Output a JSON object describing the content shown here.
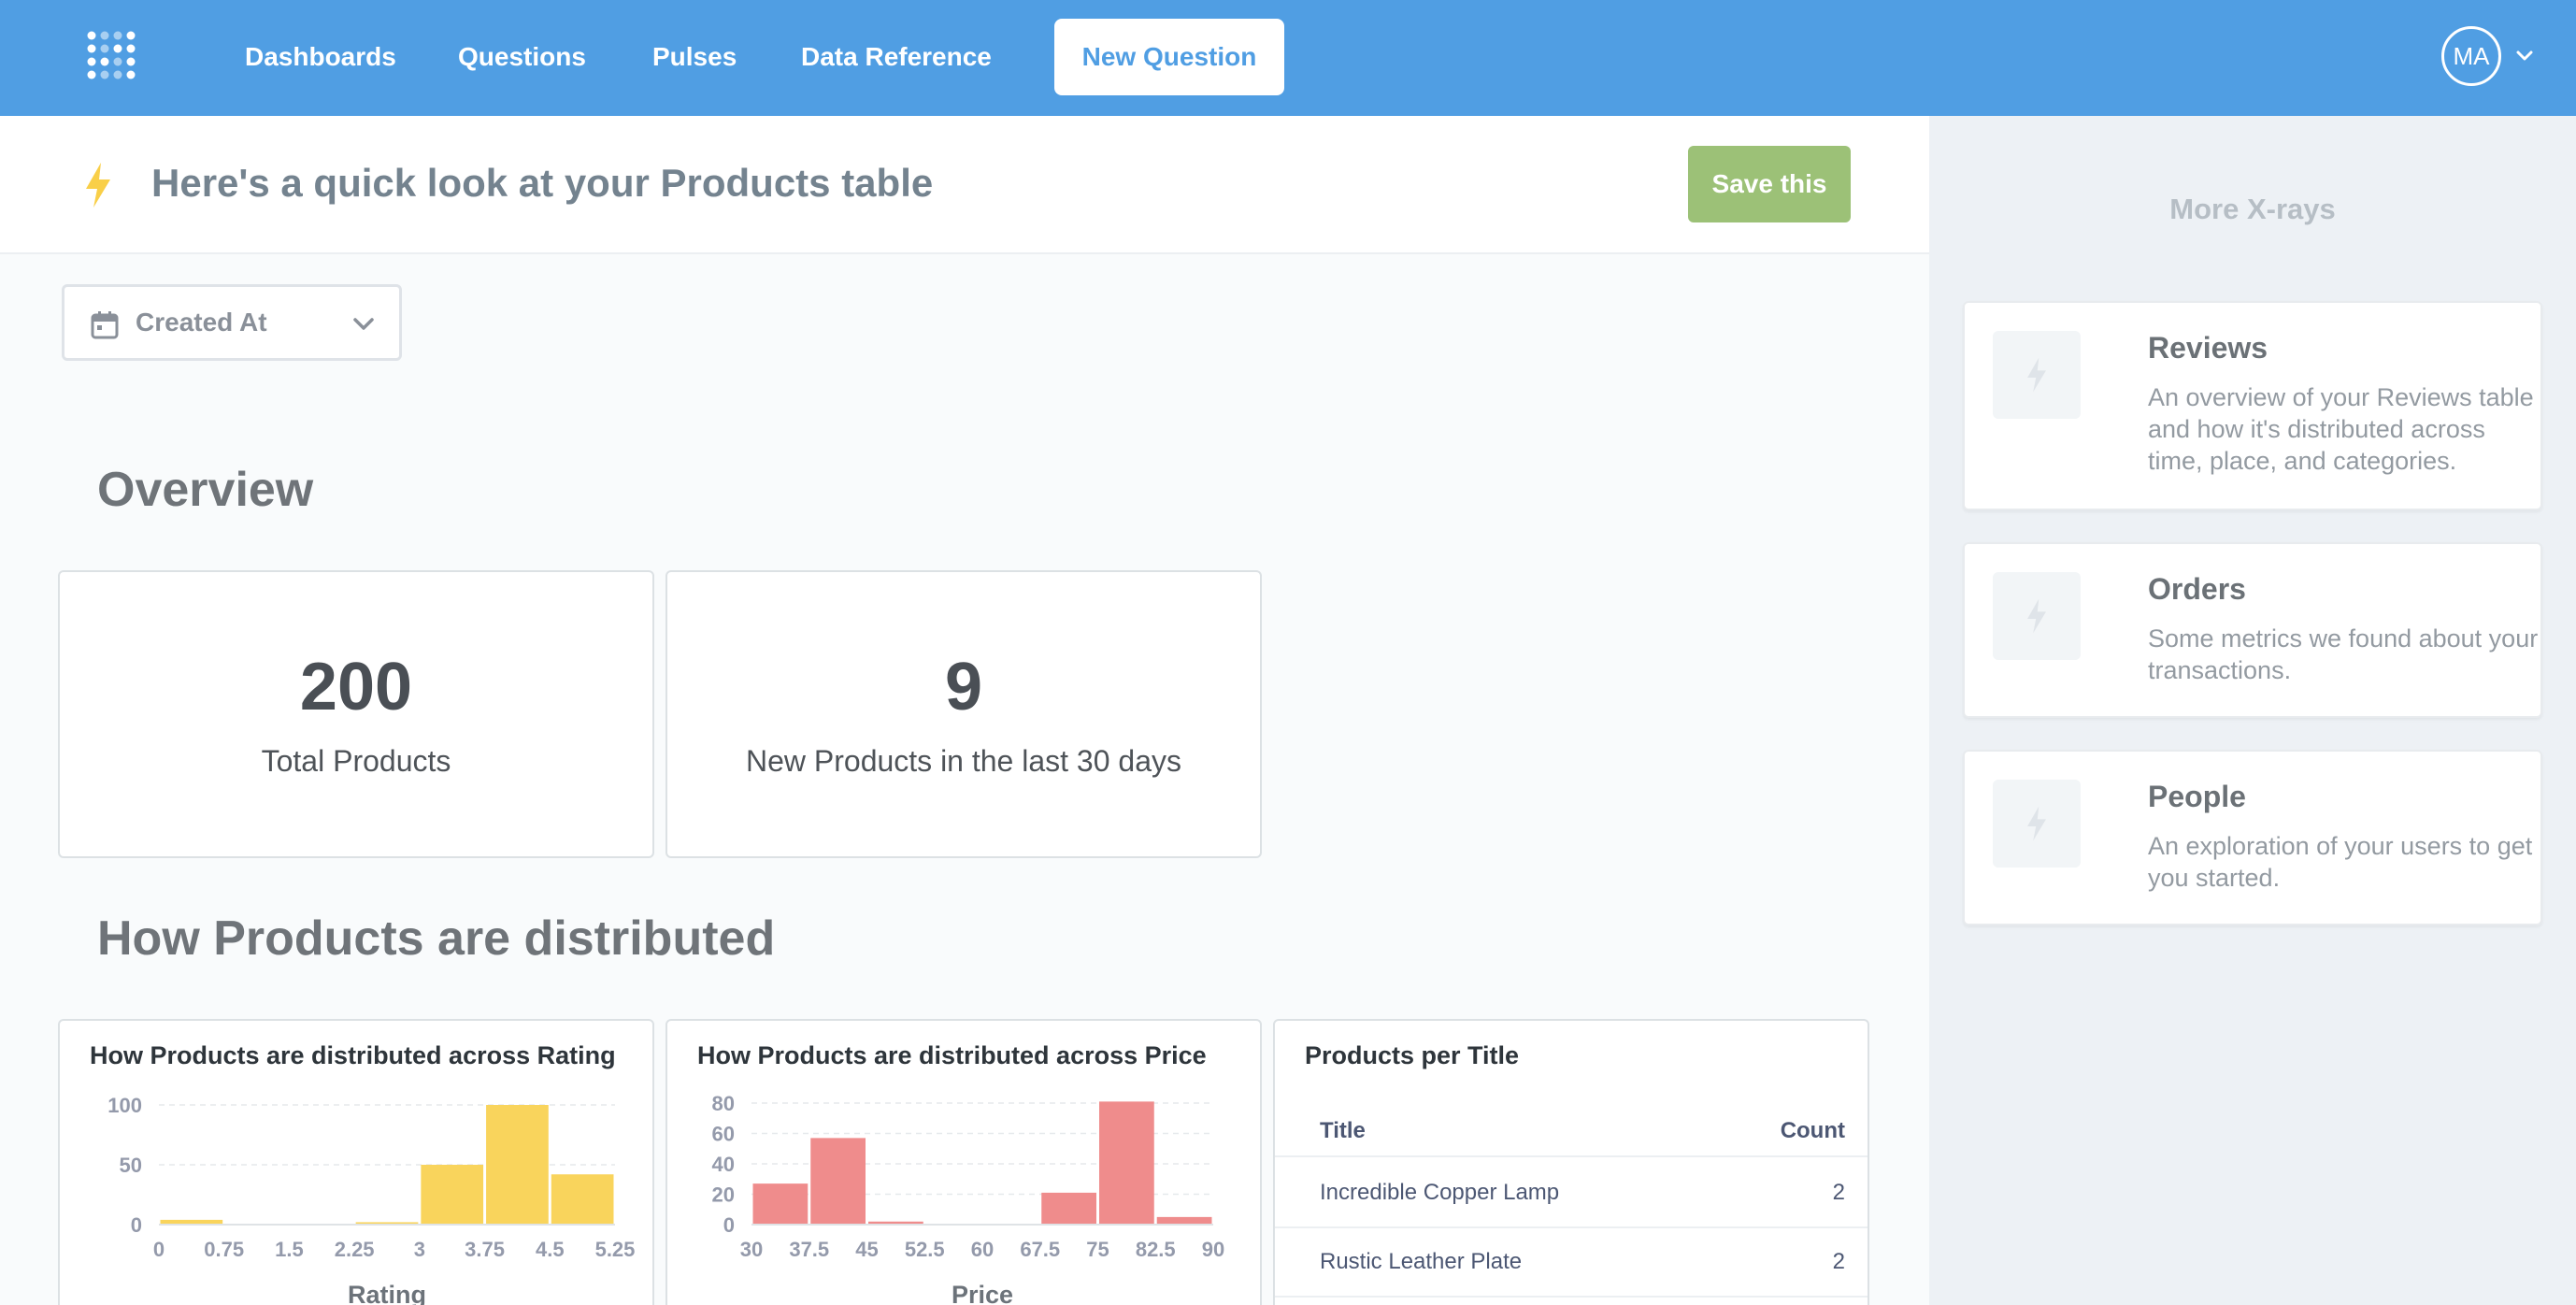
{
  "nav": {
    "logo_icon": "metabase-logo-icon",
    "links": [
      "Dashboards",
      "Questions",
      "Pulses",
      "Data Reference"
    ],
    "new_question": "New Question",
    "avatar_initials": "MA"
  },
  "hero": {
    "icon": "bolt-icon",
    "title": "Here's a quick look at your Products table",
    "save_label": "Save this"
  },
  "filter": {
    "icon": "calendar-icon",
    "label": "Created At"
  },
  "sections": {
    "overview": "Overview",
    "distribution": "How Products are distributed"
  },
  "scalars": [
    {
      "value": "200",
      "label": "Total Products"
    },
    {
      "value": "9",
      "label": "New Products in the last 30 days"
    }
  ],
  "chart_data": [
    {
      "type": "bar",
      "title": "How Products are distributed across Rating",
      "xlabel": "Rating",
      "ylabel": "",
      "x_ticks": [
        "0",
        "0.75",
        "1.5",
        "2.25",
        "3",
        "3.75",
        "4.5",
        "5.25"
      ],
      "bin_edges": [
        0,
        0.75,
        1.5,
        2.25,
        3,
        3.75,
        4.5,
        5.25
      ],
      "values": [
        4,
        0,
        0,
        2,
        50,
        100,
        42
      ],
      "y_ticks": [
        0,
        50,
        100
      ],
      "ylim": [
        0,
        100
      ],
      "color": "#f9d45c",
      "grid": true
    },
    {
      "type": "bar",
      "title": "How Products are distributed across Price",
      "xlabel": "Price",
      "ylabel": "",
      "x_ticks": [
        "30",
        "37.5",
        "45",
        "52.5",
        "60",
        "67.5",
        "75",
        "82.5",
        "90"
      ],
      "bin_edges": [
        30,
        37.5,
        45,
        52.5,
        60,
        67.5,
        75,
        82.5,
        90
      ],
      "values": [
        27,
        57,
        2,
        0,
        0,
        21,
        81,
        5
      ],
      "y_ticks": [
        0,
        20,
        40,
        60,
        80
      ],
      "ylim": [
        0,
        80
      ],
      "color": "#ef8c8c",
      "grid": true
    },
    {
      "type": "table",
      "title": "Products per Title",
      "columns": [
        "Title",
        "Count"
      ],
      "rows": [
        [
          "Incredible Copper Lamp",
          "2"
        ],
        [
          "Rustic Leather Plate",
          "2"
        ]
      ]
    }
  ],
  "sidebar": {
    "title": "More X-rays",
    "items": [
      {
        "name": "Reviews",
        "description": "An overview of your Reviews table and how it's distributed across time, place, and categories.",
        "icon": "bolt-icon"
      },
      {
        "name": "Orders",
        "description": "Some metrics we found about your transactions.",
        "icon": "bolt-icon"
      },
      {
        "name": "People",
        "description": "An exploration of your users to get you started.",
        "icon": "bolt-icon"
      }
    ]
  },
  "colors": {
    "brand": "#509ee3",
    "save_green": "#9cc177",
    "rating_bar": "#f9d45c",
    "price_bar": "#ef8c8c",
    "bolt_yellow": "#f9cf48"
  }
}
